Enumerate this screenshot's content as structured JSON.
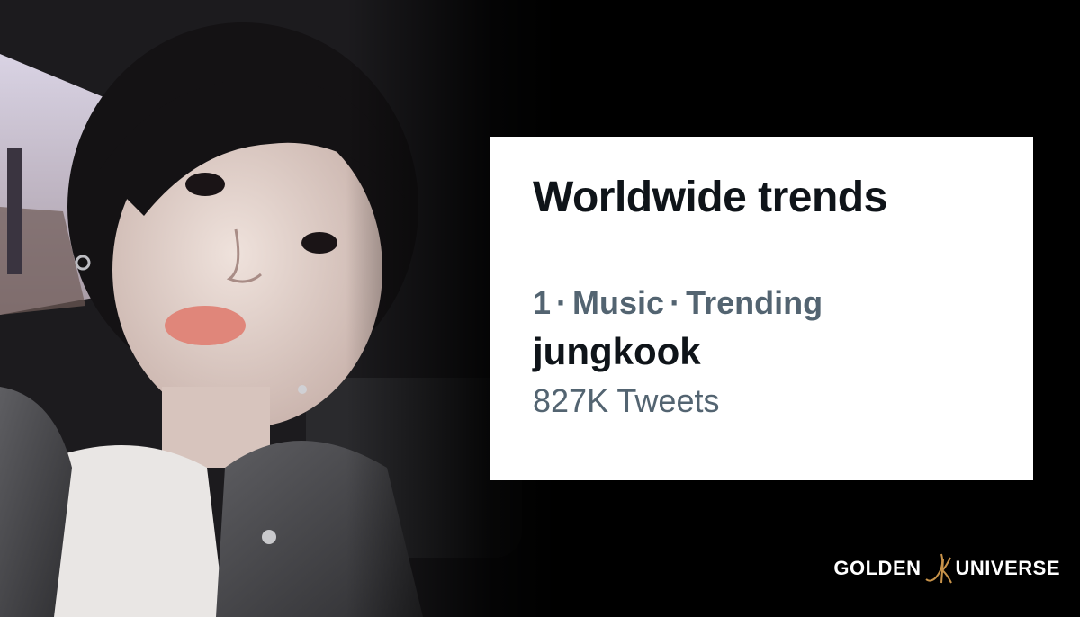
{
  "trend_card": {
    "title": "Worldwide trends",
    "rank": "1",
    "category": "Music",
    "status": "Trending",
    "separator": "·",
    "name": "jungkook",
    "tweet_count": "827K Tweets"
  },
  "watermark": {
    "left_text": "GOLDEN",
    "monogram": "JK",
    "right_text": "UNIVERSE",
    "monogram_color": "#c8934a"
  },
  "colors": {
    "background": "#000000",
    "card_background": "#ffffff",
    "primary_text": "#0f1419",
    "secondary_text": "#536471"
  }
}
